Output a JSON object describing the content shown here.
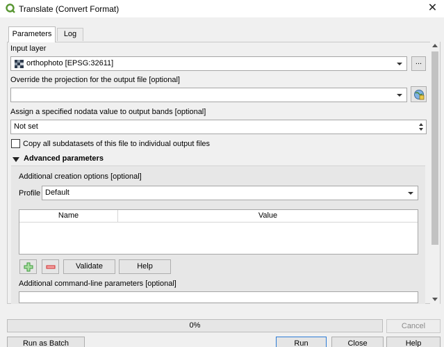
{
  "window": {
    "title": "Translate (Convert Format)",
    "close_glyph": "✕",
    "app_icon": "qgis-icon"
  },
  "tabs": [
    {
      "label": "Parameters",
      "active": true
    },
    {
      "label": "Log",
      "active": false
    }
  ],
  "params": {
    "input_layer_label": "Input layer",
    "input_layer_value": "orthophoto [EPSG:32611]",
    "input_layer_browse": "...",
    "projection_label": "Override the projection for the output file [optional]",
    "projection_value": "",
    "nodata_label": "Assign a specified nodata value to output bands [optional]",
    "nodata_value": "Not set",
    "copy_subdatasets_label": "Copy all subdatasets of this file to individual output files",
    "copy_subdatasets_checked": false
  },
  "advanced": {
    "header": "Advanced parameters",
    "expanded": true,
    "creation_options_label": "Additional creation options [optional]",
    "profile_label": "Profile",
    "profile_value": "Default",
    "table_headers": [
      "Name",
      "Value"
    ],
    "validate_label": "Validate",
    "help_label": "Help",
    "cmdline_label": "Additional command-line parameters [optional]"
  },
  "progress": {
    "text": "0%",
    "value": 0
  },
  "buttons": {
    "cancel": "Cancel",
    "batch": "Run as Batch Process...",
    "run": "Run",
    "close": "Close",
    "help": "Help"
  },
  "colors": {
    "qgis_green": "#589632",
    "add_green": "#3a9a3a",
    "remove_red": "#d03030",
    "focus_blue": "#2b7bd6"
  }
}
